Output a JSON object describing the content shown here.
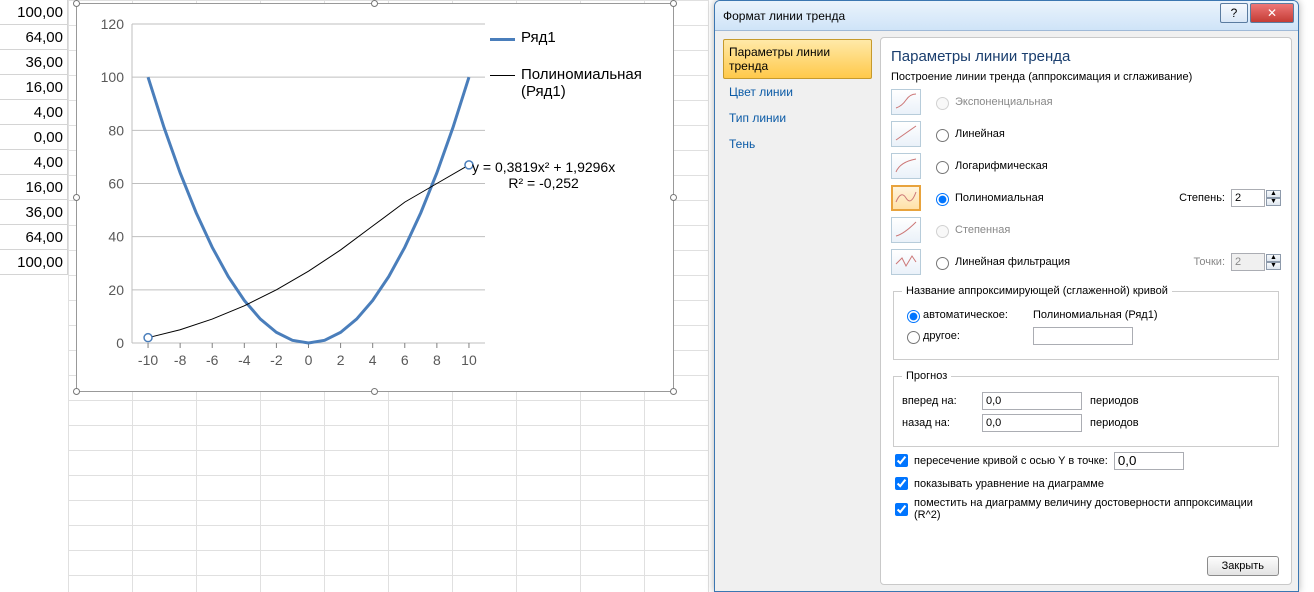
{
  "cells": [
    "100,00",
    "64,00",
    "36,00",
    "16,00",
    "4,00",
    "0,00",
    "4,00",
    "16,00",
    "36,00",
    "64,00",
    "100,00"
  ],
  "chart_data": {
    "type": "line",
    "xlim": [
      -11,
      11
    ],
    "ylim": [
      0,
      120
    ],
    "xticks": [
      -10,
      -8,
      -6,
      -4,
      -2,
      0,
      2,
      4,
      6,
      8,
      10
    ],
    "yticks": [
      0,
      20,
      40,
      60,
      80,
      100,
      120
    ],
    "series": [
      {
        "name": "Ряд1",
        "color": "#4a7ebb",
        "width": 3,
        "x": [
          -10,
          -9,
          -8,
          -7,
          -6,
          -5,
          -4,
          -3,
          -2,
          -1,
          0,
          1,
          2,
          3,
          4,
          5,
          6,
          7,
          8,
          9,
          10
        ],
        "y": [
          100,
          81,
          64,
          49,
          36,
          25,
          16,
          9,
          4,
          1,
          0,
          1,
          4,
          9,
          16,
          25,
          36,
          49,
          64,
          81,
          100
        ]
      }
    ],
    "trendline": {
      "name": "Полиномиальная (Ряд1)",
      "color": "#000",
      "width": 1,
      "equation": "y = 0,3819x² + 1,9296x",
      "r2": "R² = -0,252",
      "x": [
        -10,
        -8,
        -6,
        -4,
        -2,
        0,
        2,
        4,
        6,
        8,
        10
      ],
      "y": [
        2,
        5,
        9,
        14,
        20,
        27,
        35,
        44,
        53,
        60,
        67
      ],
      "endpoints": [
        {
          "x": -10,
          "y": 2
        },
        {
          "x": 10,
          "y": 67
        }
      ]
    },
    "legend": {
      "series": "Ряд1",
      "trend": "Полиномиальная (Ряд1)"
    }
  },
  "dialog": {
    "title": "Формат линии тренда",
    "nav": {
      "params": "Параметры линии тренда",
      "lineColor": "Цвет линии",
      "lineType": "Тип линии",
      "shadow": "Тень"
    },
    "heading": "Параметры линии тренда",
    "build_label": "Построение линии тренда (аппроксимация и сглаживание)",
    "types": {
      "exp": "Экспоненциальная",
      "lin": "Линейная",
      "log": "Логарифмическая",
      "poly": "Полиномиальная",
      "pow": "Степенная",
      "ma": "Линейная фильтрация"
    },
    "degree_label": "Степень:",
    "degree_value": "2",
    "points_label": "Точки:",
    "points_value": "2",
    "name_group": "Название аппроксимирующей (сглаженной) кривой",
    "name_auto": "автоматическое:",
    "name_auto_val": "Полиномиальная (Ряд1)",
    "name_other": "другое:",
    "name_other_val": "",
    "forecast": "Прогноз",
    "fwd_lbl": "вперед на:",
    "fwd_val": "0,0",
    "periods": "периодов",
    "bwd_lbl": "назад на:",
    "bwd_val": "0,0",
    "intercept": "пересечение кривой с осью Y в точке:",
    "intercept_val": "0,0",
    "show_eq": "показывать уравнение на диаграмме",
    "show_r2": "поместить на диаграмму величину достоверности аппроксимации (R^2)",
    "close": "Закрыть"
  }
}
